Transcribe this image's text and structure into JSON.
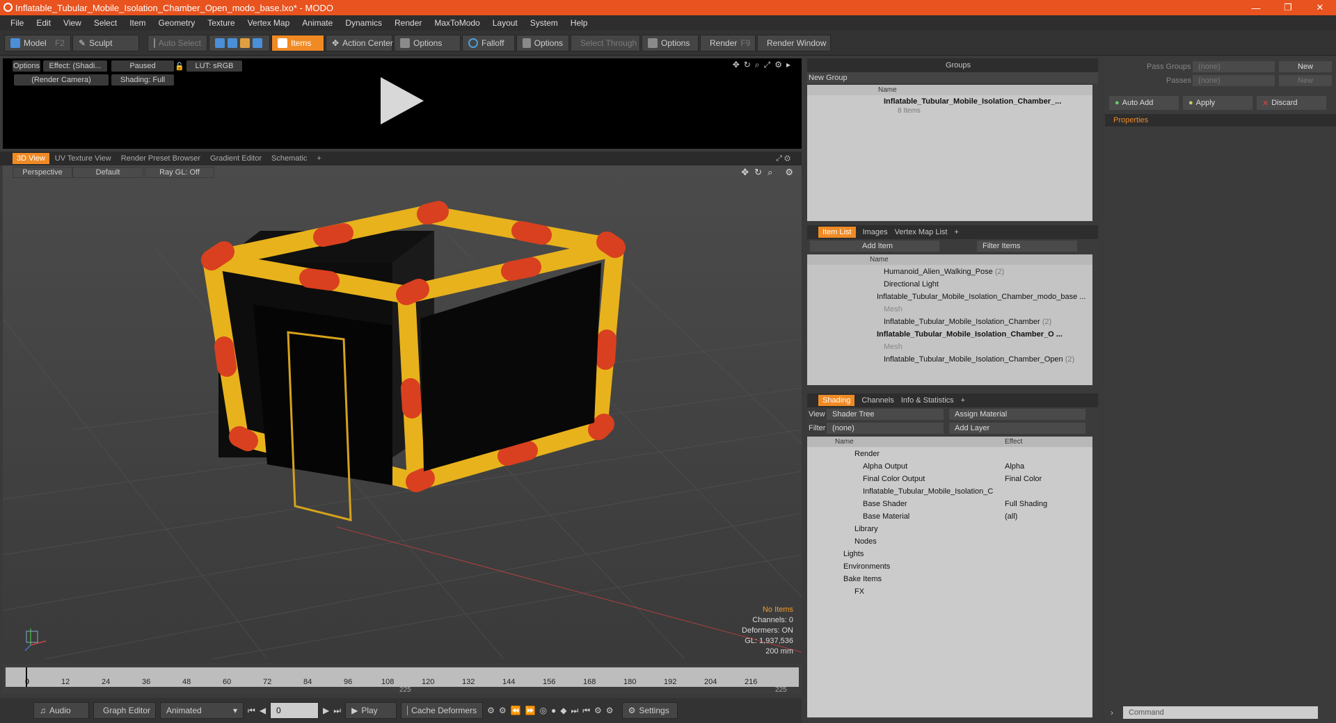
{
  "window": {
    "title": "Inflatable_Tubular_Mobile_Isolation_Chamber_Open_modo_base.lxo* - MODO",
    "controls": [
      "—",
      "❐",
      "✕"
    ]
  },
  "menu": [
    "File",
    "Edit",
    "View",
    "Select",
    "Item",
    "Geometry",
    "Texture",
    "Vertex Map",
    "Animate",
    "Dynamics",
    "Render",
    "MaxToModo",
    "Layout",
    "System",
    "Help"
  ],
  "toolbar": {
    "model": "Model",
    "model_key": "F2",
    "sculpt": "Sculpt",
    "auto_select": "Auto Select",
    "items": "Items",
    "action_center": "Action Center",
    "options": "Options",
    "falloff": "Falloff",
    "select_through": "Select Through",
    "render": "Render",
    "render_key": "F9",
    "render_window": "Render Window"
  },
  "render_preview": {
    "options": "Options",
    "effect": "Effect: (Shadi...",
    "paused": "Paused",
    "lut": "LUT: sRGB",
    "camera": "(Render Camera)",
    "shading": "Shading: Full"
  },
  "viewport_tabs": [
    "3D View",
    "UV Texture View",
    "Render Preset Browser",
    "Gradient Editor",
    "Schematic",
    "+"
  ],
  "viewport": {
    "perspective": "Perspective",
    "default": "Default",
    "raygl": "Ray GL: Off",
    "info": {
      "no_items": "No Items",
      "channels": "Channels: 0",
      "deformers": "Deformers: ON",
      "gl": "GL: 1,937,536",
      "scale": "200 mm"
    }
  },
  "timeline": {
    "labels": [
      "0",
      "12",
      "24",
      "36",
      "48",
      "60",
      "72",
      "84",
      "96",
      "108",
      "120",
      "132",
      "144",
      "156",
      "168",
      "180",
      "192",
      "204",
      "216"
    ],
    "end": "225",
    "mid": "225"
  },
  "statusbar": {
    "audio": "Audio",
    "graph_editor": "Graph Editor",
    "animated": "Animated",
    "frame": "0",
    "play": "Play",
    "cache": "Cache Deformers",
    "settings": "Settings"
  },
  "groups": {
    "title": "Groups",
    "new_group": "New Group",
    "col_name": "Name",
    "item_name": "Inflatable_Tubular_Mobile_Isolation_Chamber_...",
    "item_count": "8 Items"
  },
  "right_panel": {
    "pass_groups": "Pass Groups",
    "passes": "Passes",
    "none": "(none)",
    "new": "New",
    "auto_add": "Auto Add",
    "apply": "Apply",
    "discard": "Discard",
    "properties": "Properties",
    "command": "Command"
  },
  "item_list": {
    "tabs": [
      "Item List",
      "Images",
      "Vertex Map List",
      "+"
    ],
    "add_item": "Add Item",
    "filter": "Filter Items",
    "col_name": "Name",
    "rows": [
      {
        "label": "Humanoid_Alien_Walking_Pose",
        "count": "(2)"
      },
      {
        "label": "Directional Light",
        "count": ""
      },
      {
        "label": "Inflatable_Tubular_Mobile_Isolation_Chamber_modo_base ...",
        "count": ""
      },
      {
        "label": "Mesh",
        "count": ""
      },
      {
        "label": "Inflatable_Tubular_Mobile_Isolation_Chamber",
        "count": "(2)"
      },
      {
        "label": "Inflatable_Tubular_Mobile_Isolation_Chamber_O ...",
        "count": ""
      },
      {
        "label": "Mesh",
        "count": ""
      },
      {
        "label": "Inflatable_Tubular_Mobile_Isolation_Chamber_Open",
        "count": "(2)"
      }
    ]
  },
  "shading": {
    "tabs": [
      "Shading",
      "Channels",
      "Info & Statistics",
      "+"
    ],
    "view_label": "View",
    "view_value": "Shader Tree",
    "assign": "Assign Material",
    "filter_label": "Filter",
    "filter_value": "(none)",
    "add_layer": "Add Layer",
    "col_name": "Name",
    "col_effect": "Effect",
    "rows": [
      {
        "label": "Render",
        "effect": ""
      },
      {
        "label": "Alpha Output",
        "effect": "Alpha"
      },
      {
        "label": "Final Color Output",
        "effect": "Final Color"
      },
      {
        "label": "Inflatable_Tubular_Mobile_Isolation_C",
        "effect": ""
      },
      {
        "label": "Base Shader",
        "effect": "Full Shading"
      },
      {
        "label": "Base Material",
        "effect": "(all)"
      },
      {
        "label": "Library",
        "effect": ""
      },
      {
        "label": "Nodes",
        "effect": ""
      },
      {
        "label": "Lights",
        "effect": ""
      },
      {
        "label": "Environments",
        "effect": ""
      },
      {
        "label": "Bake Items",
        "effect": ""
      },
      {
        "label": "FX",
        "effect": ""
      }
    ]
  },
  "colors": {
    "accent": "#f08a24",
    "title_bar": "#e8531f",
    "frame_yellow": "#e8b21c",
    "frame_red": "#d9401f"
  }
}
